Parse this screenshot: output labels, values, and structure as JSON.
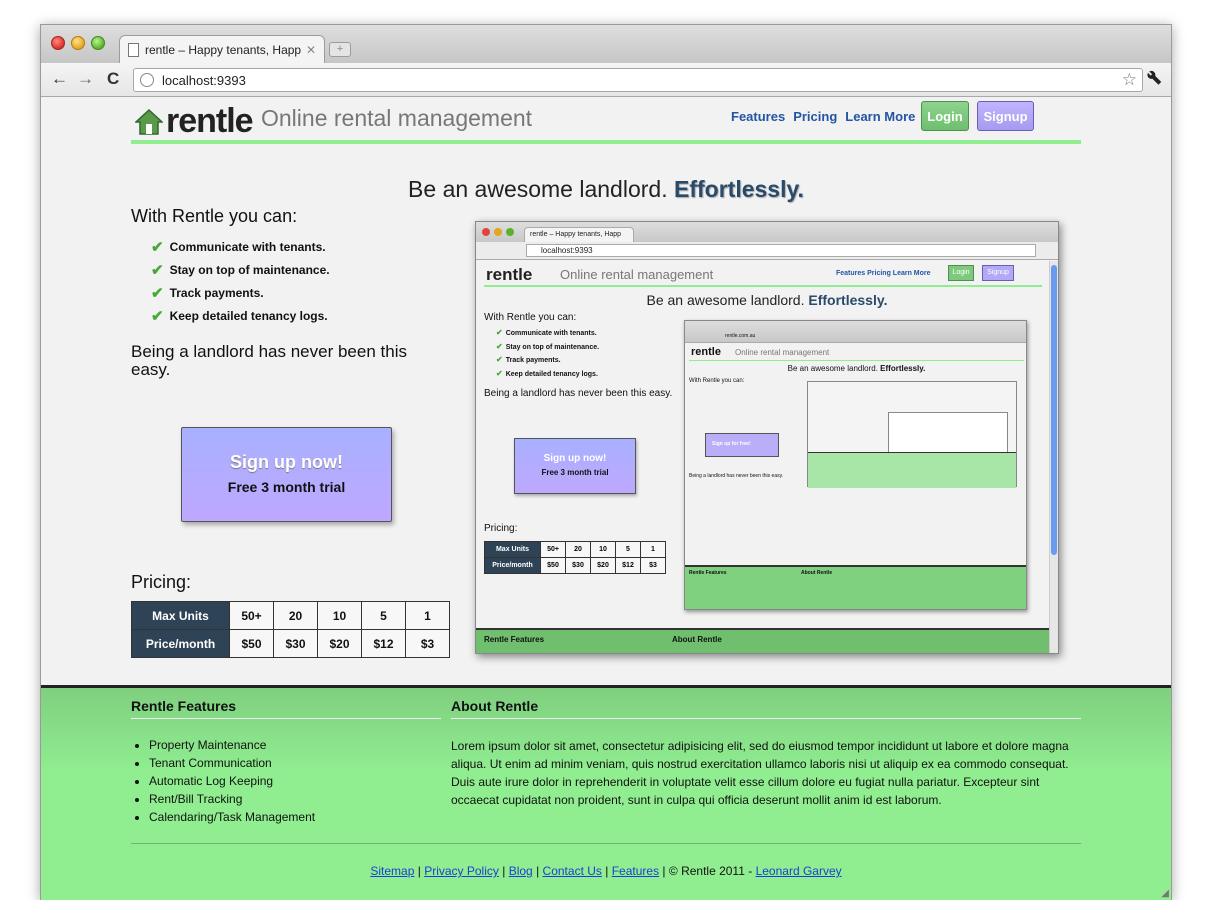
{
  "browser": {
    "tab_title": "rentle – Happy tenants, Happ",
    "tab_close": "✕",
    "new_tab": "+",
    "back": "←",
    "forward": "→",
    "reload": "C",
    "url": "localhost:9393",
    "bookmark": "☆",
    "wrench": "🔧"
  },
  "header": {
    "logo_text": "rentle",
    "tagline": "Online rental management",
    "nav": [
      "Features",
      "Pricing",
      "Learn More"
    ],
    "login": "Login",
    "signup": "Signup"
  },
  "hero": {
    "title": "Be an awesome landlord.",
    "title_emph": "Effortlessly."
  },
  "benefits": {
    "heading": "With Rentle you can:",
    "check": "✔",
    "items": [
      "Communicate with tenants.",
      "Stay on top of maintenance.",
      "Track payments.",
      "Keep detailed tenancy logs."
    ],
    "easy": "Being a landlord has never been this easy."
  },
  "cta": {
    "main": "Sign up now!",
    "sub": "Free 3 month trial"
  },
  "pricing": {
    "heading": "Pricing:",
    "row1_label": "Max Units",
    "row2_label": "Price/month",
    "units": [
      "50+",
      "20",
      "10",
      "5",
      "1"
    ],
    "prices": [
      "$50",
      "$30",
      "$20",
      "$12",
      "$3"
    ]
  },
  "screenshot": {
    "tab_title": "rentle – Happy tenants, Happ",
    "url": "localhost:9393",
    "nav": "Features  Pricing  Learn More",
    "nested_url": "rentle.com.au",
    "nested_cta": "Sign up for free!",
    "nested_easy": "Being a landlord has never been this easy.",
    "nested_features_heading": "Rentle Features",
    "nested_about_heading": "About Rentle",
    "footer_features": "Rentle Features",
    "footer_about": "About Rentle"
  },
  "footer": {
    "features_heading": "Rentle Features",
    "features": [
      "Property Maintenance",
      "Tenant Communication",
      "Automatic Log Keeping",
      "Rent/Bill Tracking",
      "Calendaring/Task Management"
    ],
    "about_heading": "About Rentle",
    "about_text": "Lorem ipsum dolor sit amet, consectetur adipisicing elit, sed do eiusmod tempor incididunt ut labore et dolore magna aliqua. Ut enim ad minim veniam, quis nostrud exercitation ullamco laboris nisi ut aliquip ex ea commodo consequat. Duis aute irure dolor in reprehenderit in voluptate velit esse cillum dolore eu fugiat nulla pariatur. Excepteur sint occaecat cupidatat non proident, sunt in culpa qui officia deserunt mollit anim id est laborum.",
    "links": [
      "Sitemap",
      "Privacy Policy",
      "Blog",
      "Contact Us",
      "Features"
    ],
    "separator": "|",
    "copyright": "© Rentle 2011 -",
    "author": "Leonard Garvey"
  },
  "colors": {
    "accent_green": "#90ee90",
    "nav_blue": "#2255a4",
    "table_header": "#2f4356",
    "cta_purple": "#bea8ff"
  }
}
